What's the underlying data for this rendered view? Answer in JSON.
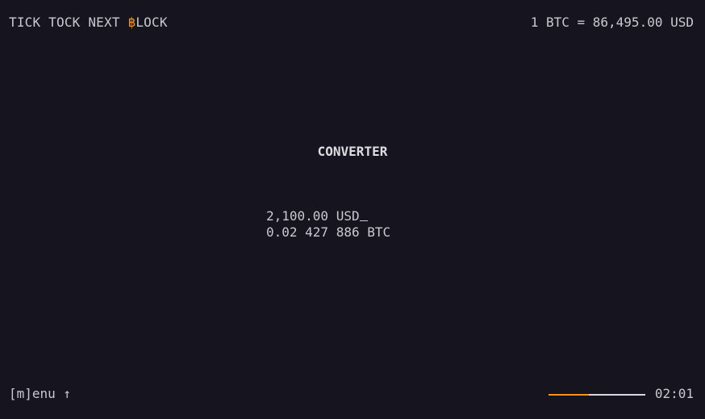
{
  "header": {
    "brand": {
      "prefix": "TICK TOCK NEXT ",
      "accent": "฿",
      "suffix": "LOCK"
    },
    "rate": "1 BTC = 86,495.00 USD"
  },
  "converter": {
    "title": "CONVERTER",
    "usd_value": "2,100.00",
    "usd_unit": "USD",
    "btc_value": "0.02 427 886",
    "btc_unit": "BTC"
  },
  "footer": {
    "menu": "[m]enu ↑",
    "progress_fraction": 0.42,
    "timer": "02:01"
  },
  "colors": {
    "background": "#16141f",
    "text": "#c9c9d0",
    "accent": "#f7931a"
  }
}
